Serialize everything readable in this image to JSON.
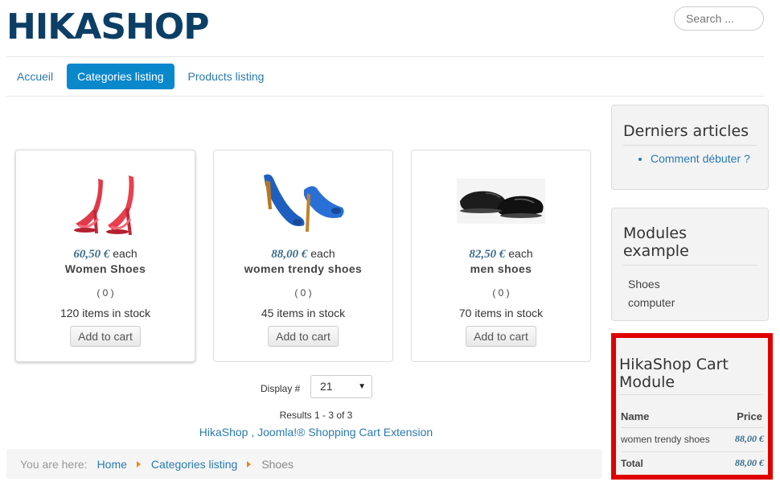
{
  "site": {
    "logo": "HIKASHOP",
    "search_placeholder": "Search ..."
  },
  "nav": [
    {
      "label": "Accueil",
      "active": false
    },
    {
      "label": "Categories listing",
      "active": true
    },
    {
      "label": "Products listing",
      "active": false
    }
  ],
  "products": [
    {
      "price": "60,50 €",
      "each": "each",
      "name": "Women Shoes",
      "votes": "( 0 )",
      "stock": "120 items in stock",
      "button": "Add to cart",
      "image": "red-sandal-image"
    },
    {
      "price": "88,00 €",
      "each": "each",
      "name": "women trendy shoes",
      "votes": "( 0 )",
      "stock": "45 items in stock",
      "button": "Add to cart",
      "image": "blue-heels-image"
    },
    {
      "price": "82,50 €",
      "each": "each",
      "name": "men shoes",
      "votes": "( 0 )",
      "stock": "70 items in stock",
      "button": "Add to cart",
      "image": "black-shoes-image"
    }
  ],
  "pagination": {
    "display_label": "Display #",
    "display_value": "21",
    "results": "Results 1 - 3 of 3"
  },
  "footer_link": "HikaShop , Joomla!® Shopping Cart Extension",
  "breadcrumb": {
    "prefix": "You are here:",
    "items": [
      "Home",
      "Categories listing"
    ],
    "current": "Shoes"
  },
  "modules": {
    "latest": {
      "title": "Derniers articles",
      "items": [
        "Comment débuter ?"
      ]
    },
    "example": {
      "title": "Modules example",
      "items": [
        "Shoes",
        "computer"
      ]
    },
    "cart": {
      "title": "HikaShop Cart Module",
      "col_name": "Name",
      "col_price": "Price",
      "rows": [
        {
          "name": "women trendy shoes",
          "price": "88,00 €"
        }
      ],
      "total_label": "Total",
      "total_price": "88,00 €"
    }
  },
  "colors": {
    "accent": "#0a88cc",
    "link": "#2a7ab0",
    "price": "#3a6d8c",
    "highlight": "#e00000",
    "logo": "#0c3f66"
  }
}
